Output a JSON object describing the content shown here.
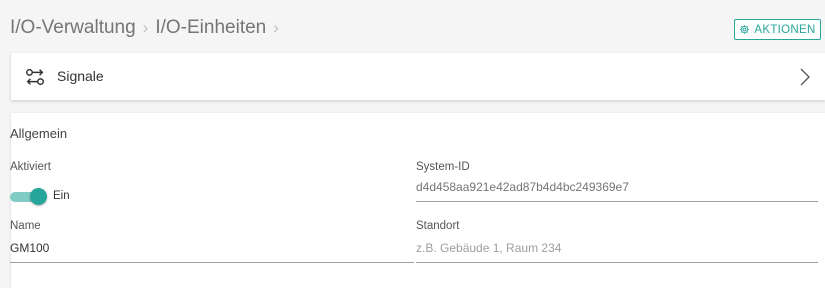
{
  "breadcrumb": {
    "items": [
      "I/O-Verwaltung",
      "I/O-Einheiten"
    ],
    "separator": "›"
  },
  "header": {
    "actions_label": "AKTIONEN",
    "actions_icon": "gear-icon"
  },
  "signals": {
    "label": "Signale",
    "icon": "signal-exchange-icon"
  },
  "general": {
    "title": "Allgemein",
    "activated": {
      "label": "Aktiviert",
      "state_text": "Ein",
      "on": true
    },
    "system_id": {
      "label": "System-ID",
      "value": "d4d458aa921e42ad87b4d4bc249369e7"
    },
    "name": {
      "label": "Name",
      "value": "GM100"
    },
    "location": {
      "label": "Standort",
      "placeholder": "z.B. Gebäude 1, Raum 234"
    }
  },
  "colors": {
    "accent": "#26a69a",
    "accent_light": "#80cbc4",
    "background": "#f5f5f5"
  }
}
